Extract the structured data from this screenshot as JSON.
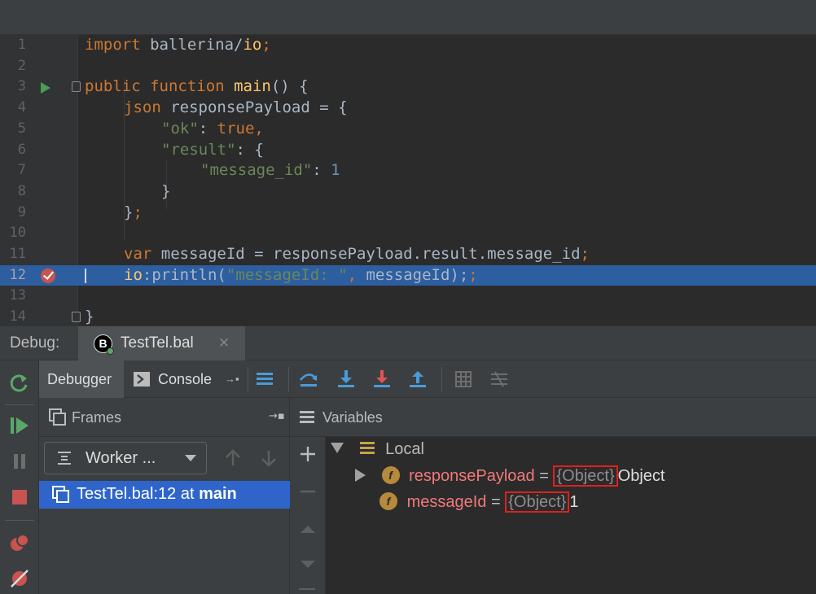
{
  "editor": {
    "lines": [
      {
        "n": "1"
      },
      {
        "n": "2"
      },
      {
        "n": "3"
      },
      {
        "n": "4"
      },
      {
        "n": "5"
      },
      {
        "n": "6"
      },
      {
        "n": "7"
      },
      {
        "n": "8"
      },
      {
        "n": "9"
      },
      {
        "n": "10"
      },
      {
        "n": "11"
      },
      {
        "n": "12"
      },
      {
        "n": "13"
      },
      {
        "n": "14"
      }
    ],
    "code": {
      "l1": [
        "import",
        " ballerina/",
        "io",
        ";"
      ],
      "l3": [
        "public",
        " ",
        "function",
        " ",
        "main",
        "() {"
      ],
      "l4": [
        "json",
        " responsePayload = {"
      ],
      "l5": [
        "\"ok\"",
        ": ",
        "true",
        ","
      ],
      "l6": [
        "\"result\"",
        ": {"
      ],
      "l7": [
        "\"message_id\"",
        ": ",
        "1"
      ],
      "l8": [
        "}"
      ],
      "l9": [
        "}",
        ";"
      ],
      "l11": [
        "var",
        " messageId = responsePayload.result.message_id",
        ";"
      ],
      "l12": [
        "io",
        ":println(",
        "\"messageId: \"",
        ", ",
        "messageId);"
      ],
      "l14": [
        "}"
      ]
    }
  },
  "debug": {
    "title": "Debug:",
    "session_tab": "TestTel.bal",
    "session_close": "×",
    "logo_letter": "B"
  },
  "tabs": {
    "debugger": "Debugger",
    "console": "Console",
    "console_suffix": "→▪"
  },
  "frames": {
    "title": "Frames",
    "pin": "→▪",
    "worker_select": "Worker ...",
    "items": [
      {
        "label": "TestTel.bal:12 at ",
        "bold": "main"
      }
    ]
  },
  "variables": {
    "title": "Variables",
    "local_label": "Local",
    "items": [
      {
        "icon": "f",
        "name": "responsePayload",
        "eq": " = ",
        "type": "{Object}",
        "value": "Object"
      },
      {
        "icon": "f",
        "name": "messageId",
        "eq": " = ",
        "type": "{Object}",
        "value": "1"
      }
    ]
  },
  "colors": {
    "accent_selection": "#2f65ca",
    "current_line": "#2d5ea0",
    "breakpoint": "#c75450",
    "highlight_box": "#e02020"
  }
}
